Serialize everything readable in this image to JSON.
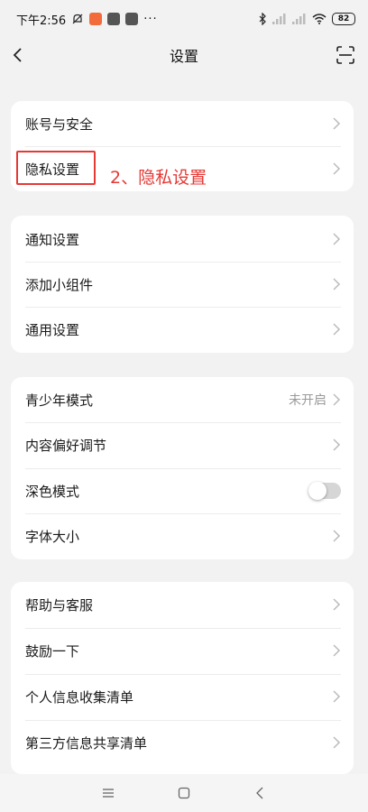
{
  "status_bar": {
    "time": "下午2:56",
    "dots": "···",
    "battery": "82"
  },
  "header": {
    "title": "设置"
  },
  "sections": [
    {
      "items": [
        {
          "label": "账号与安全"
        },
        {
          "label": "隐私设置"
        }
      ]
    },
    {
      "items": [
        {
          "label": "通知设置"
        },
        {
          "label": "添加小组件"
        },
        {
          "label": "通用设置"
        }
      ]
    },
    {
      "items": [
        {
          "label": "青少年模式",
          "value": "未开启"
        },
        {
          "label": "内容偏好调节"
        },
        {
          "label": "深色模式",
          "toggle": false
        },
        {
          "label": "字体大小"
        }
      ]
    },
    {
      "items": [
        {
          "label": "帮助与客服"
        },
        {
          "label": "鼓励一下"
        },
        {
          "label": "个人信息收集清单"
        },
        {
          "label": "第三方信息共享清单"
        }
      ]
    }
  ],
  "annotation": {
    "text": "2、隐私设置",
    "color": "#e53935"
  },
  "icons": {
    "back": "chevron-left-icon",
    "scan": "scan-icon",
    "menu": "menu-icon",
    "home": "home-icon",
    "nav_back": "nav-back-icon"
  }
}
